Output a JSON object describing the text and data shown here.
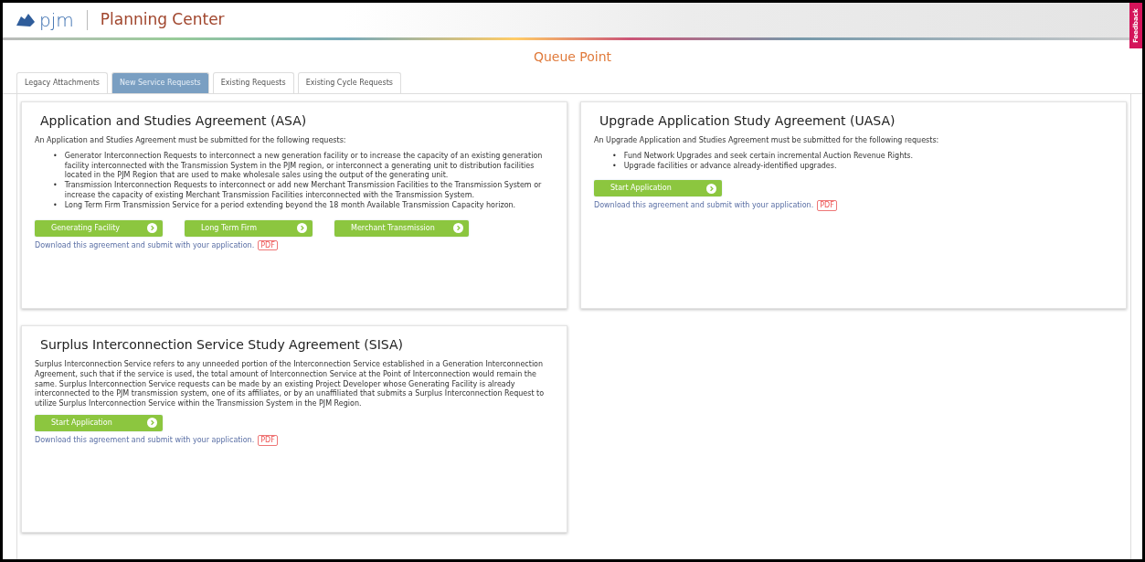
{
  "header": {
    "logo": "pjm",
    "title": "Planning Center",
    "feedback": "Feedback"
  },
  "page_title": "Queue Point",
  "bullet_marker": "•",
  "tabs": [
    {
      "label": "Legacy Attachments",
      "selected": false
    },
    {
      "label": "New Service Requests",
      "selected": true
    },
    {
      "label": "Existing Requests",
      "selected": false
    },
    {
      "label": "Existing Cycle Requests",
      "selected": false
    }
  ],
  "cards": [
    {
      "title": "Application and Studies Agreement (ASA)",
      "intro": "An Application and Studies Agreement must be submitted for the following requests:",
      "bullets": [
        "Generator Interconnection Requests to interconnect a new generation facility or to increase the capacity of an existing generation facility interconnected with the Transmission System in the PJM region, or interconnect a generating unit to distribution facilities located in the PJM Region that are used to make wholesale sales using the output of the generating unit.",
        "Transmission Interconnection Requests to interconnect or add new Merchant Transmission Facilities to the Transmission System or increase the capacity of existing Merchant Transmission Facilities interconnected with the Transmission System.",
        "Long Term Firm Transmission Service for a period extending beyond the 18 month Available Transmission Capacity horizon."
      ],
      "buttons": [
        "Generating Facility",
        "Long Term Firm",
        "Merchant Transmission"
      ],
      "download": "Download this agreement and submit with your application.",
      "pdf": "PDF"
    },
    {
      "title": "Upgrade Application Study Agreement (UASA)",
      "intro": "An Upgrade Application and Studies Agreement must be submitted for the following requests:",
      "bullets": [
        "Fund Network Upgrades and seek certain incremental Auction Revenue Rights.",
        "Upgrade facilities or advance already-identified upgrades."
      ],
      "buttons": [
        "Start Application"
      ],
      "download": "Download this agreement and submit with your application.",
      "pdf": "PDF"
    },
    {
      "title": "Surplus Interconnection Service Study Agreement (SISA)",
      "intro": "Surplus Interconnection Service refers to any unneeded portion of the Interconnection Service established in a Generation Interconnection Agreement, such that if the service is used, the total amount of Interconnection Service at the Point of Interconnection would remain the same. Surplus Interconnection Service requests can be made by an existing Project Developer whose Generating Facility is already interconnected to the PJM transmission system, one of its affiliates, or by an unaffiliated that submits a Surplus Interconnection Request to utilize Surplus Interconnection Service within the Transmission System in the PJM Region.",
      "buttons": [
        "Start Application"
      ],
      "download": "Download this agreement and submit with your application.",
      "pdf": "PDF"
    }
  ]
}
